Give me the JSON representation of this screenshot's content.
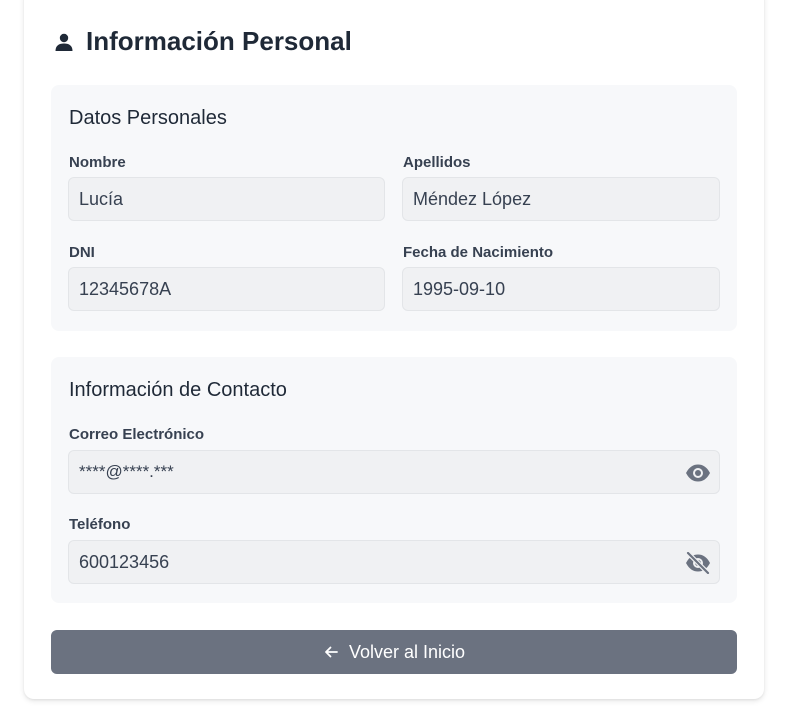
{
  "header": {
    "title": "Información Personal",
    "icon": "user-icon"
  },
  "personal": {
    "title": "Datos Personales",
    "nombre_label": "Nombre",
    "nombre_value": "Lucía",
    "apellidos_label": "Apellidos",
    "apellidos_value": "Méndez López",
    "dni_label": "DNI",
    "dni_value": "12345678A",
    "fecha_label": "Fecha de Nacimiento",
    "fecha_value": "1995-09-10"
  },
  "contact": {
    "title": "Información de Contacto",
    "email_label": "Correo Electrónico",
    "email_value": "****@****.***",
    "email_toggle_icon": "eye-icon",
    "phone_label": "Teléfono",
    "phone_value": "600123456",
    "phone_toggle_icon": "eye-slash-icon"
  },
  "back_button": {
    "label": "Volver al Inicio",
    "icon": "arrow-left-icon"
  },
  "colors": {
    "panel_bg": "#f7f8fa",
    "field_bg": "#f0f1f3",
    "button_bg": "#6b7280",
    "text": "#1f2937"
  }
}
